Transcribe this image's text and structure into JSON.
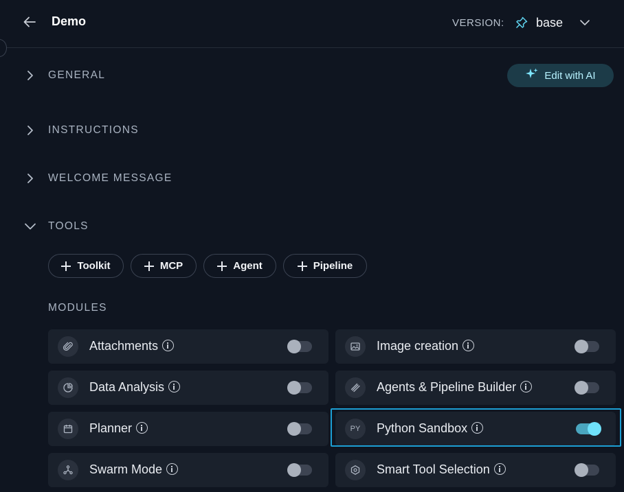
{
  "header": {
    "title": "Demo",
    "version_label": "VERSION:",
    "version_value": "base"
  },
  "sections": [
    {
      "label": "GENERAL",
      "expanded": false
    },
    {
      "label": "INSTRUCTIONS",
      "expanded": false
    },
    {
      "label": "WELCOME MESSAGE",
      "expanded": false
    },
    {
      "label": "TOOLS",
      "expanded": true
    }
  ],
  "edit_ai": {
    "label": "Edit with AI"
  },
  "tools": {
    "buttons": [
      "Toolkit",
      "MCP",
      "Agent",
      "Pipeline"
    ]
  },
  "modules": {
    "title": "MODULES",
    "items": [
      {
        "name": "Attachments",
        "icon": "paperclip-icon",
        "enabled": false
      },
      {
        "name": "Image creation",
        "icon": "image-icon",
        "enabled": false
      },
      {
        "name": "Data Analysis",
        "icon": "chart-pie-icon",
        "enabled": false
      },
      {
        "name": "Agents & Pipeline Builder",
        "icon": "builder-icon",
        "enabled": false
      },
      {
        "name": "Planner",
        "icon": "calendar-icon",
        "enabled": false
      },
      {
        "name": "Python Sandbox",
        "icon": "python-icon",
        "icon_text": "PY",
        "enabled": true
      },
      {
        "name": "Swarm Mode",
        "icon": "network-icon",
        "enabled": false
      },
      {
        "name": "Smart Tool Selection",
        "icon": "hexagon-icon",
        "enabled": false
      }
    ]
  },
  "colors": {
    "background": "#0f1520",
    "card": "#1a212c",
    "accent": "#6fe2fb",
    "highlight": "#1c9fd4"
  }
}
